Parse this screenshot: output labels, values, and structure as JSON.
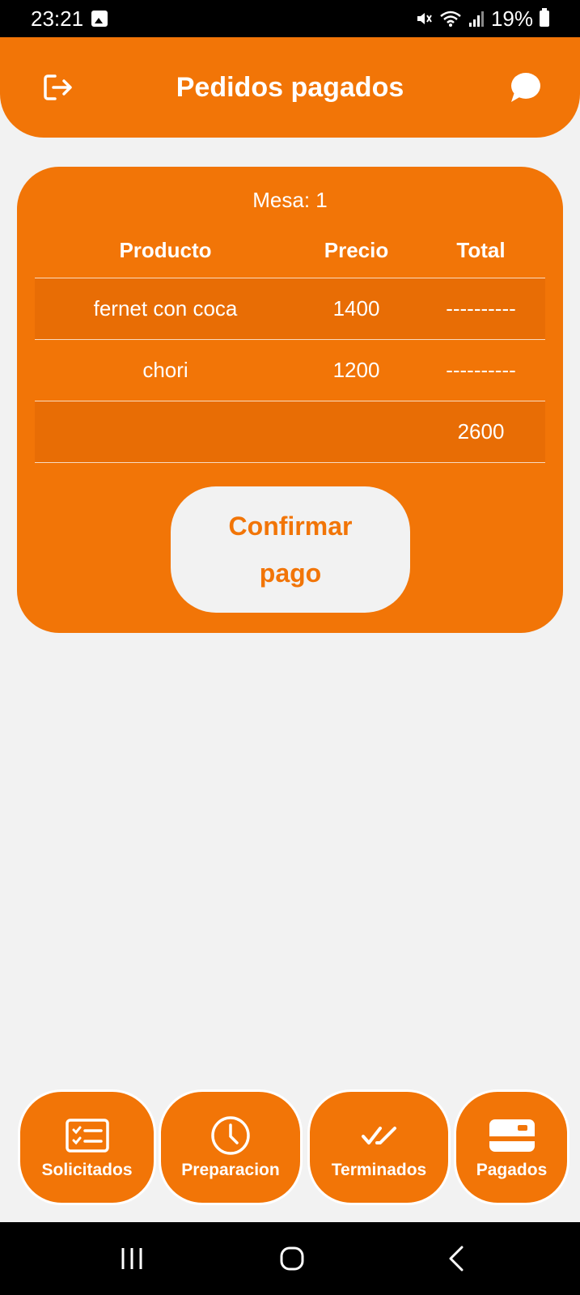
{
  "status_bar": {
    "time": "23:21",
    "battery": "19%",
    "icons": [
      "gallery-icon",
      "mute-icon",
      "wifi-icon",
      "signal-icon",
      "battery-icon"
    ]
  },
  "header": {
    "title": "Pedidos pagados",
    "left_icon": "logout-icon",
    "right_icon": "chat-icon"
  },
  "order": {
    "mesa_label": "Mesa: 1",
    "columns": {
      "product": "Producto",
      "price": "Precio",
      "total": "Total"
    },
    "rows": [
      {
        "product": "fernet con coca",
        "price": "1400",
        "total": "----------"
      },
      {
        "product": "chori",
        "price": "1200",
        "total": "----------"
      }
    ],
    "grand_total": "2600",
    "confirm_label": "Confirmar pago"
  },
  "tabs": [
    {
      "label": "Solicitados",
      "icon": "checklist-icon"
    },
    {
      "label": "Preparacion",
      "icon": "clock-icon"
    },
    {
      "label": "Terminados",
      "icon": "double-check-icon"
    },
    {
      "label": "Pagados",
      "icon": "card-icon"
    }
  ],
  "colors": {
    "accent": "#f27507",
    "accent_alt_row": "#e86d05",
    "background": "#f2f2f2"
  }
}
